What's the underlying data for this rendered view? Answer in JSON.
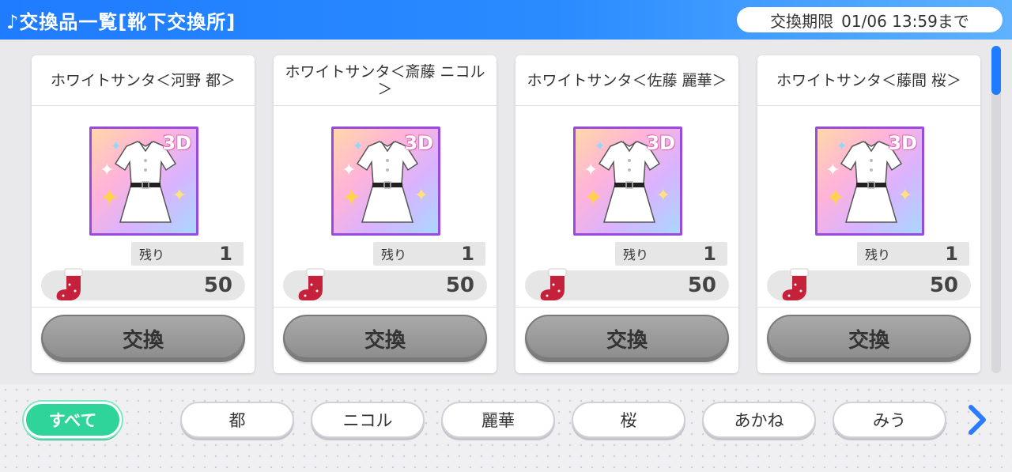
{
  "header": {
    "icon": "music-note-icon",
    "title": "♪交換品一覧[靴下交換所]",
    "deadline_label": "交換期限",
    "deadline_value": "01/06 13:59まで"
  },
  "cards": [
    {
      "name": "ホワイトサンタ＜河野 都＞",
      "badge": "3D",
      "remain_label": "残り",
      "remain": "1",
      "cost": "50",
      "button": "交換"
    },
    {
      "name": "ホワイトサンタ＜斎藤 ニコル＞",
      "badge": "3D",
      "remain_label": "残り",
      "remain": "1",
      "cost": "50",
      "button": "交換"
    },
    {
      "name": "ホワイトサンタ＜佐藤 麗華＞",
      "badge": "3D",
      "remain_label": "残り",
      "remain": "1",
      "cost": "50",
      "button": "交換"
    },
    {
      "name": "ホワイトサンタ＜藤間 桜＞",
      "badge": "3D",
      "remain_label": "残り",
      "remain": "1",
      "cost": "50",
      "button": "交換"
    }
  ],
  "filters": {
    "all": "すべて",
    "items": [
      "都",
      "ニコル",
      "麗華",
      "桜",
      "あかね",
      "みう"
    ]
  },
  "colors": {
    "header": "#1f7cff",
    "active_filter": "#2fd49a",
    "thumb_border": "#9b4ae0",
    "exchange_button": "#9a9a9a"
  }
}
